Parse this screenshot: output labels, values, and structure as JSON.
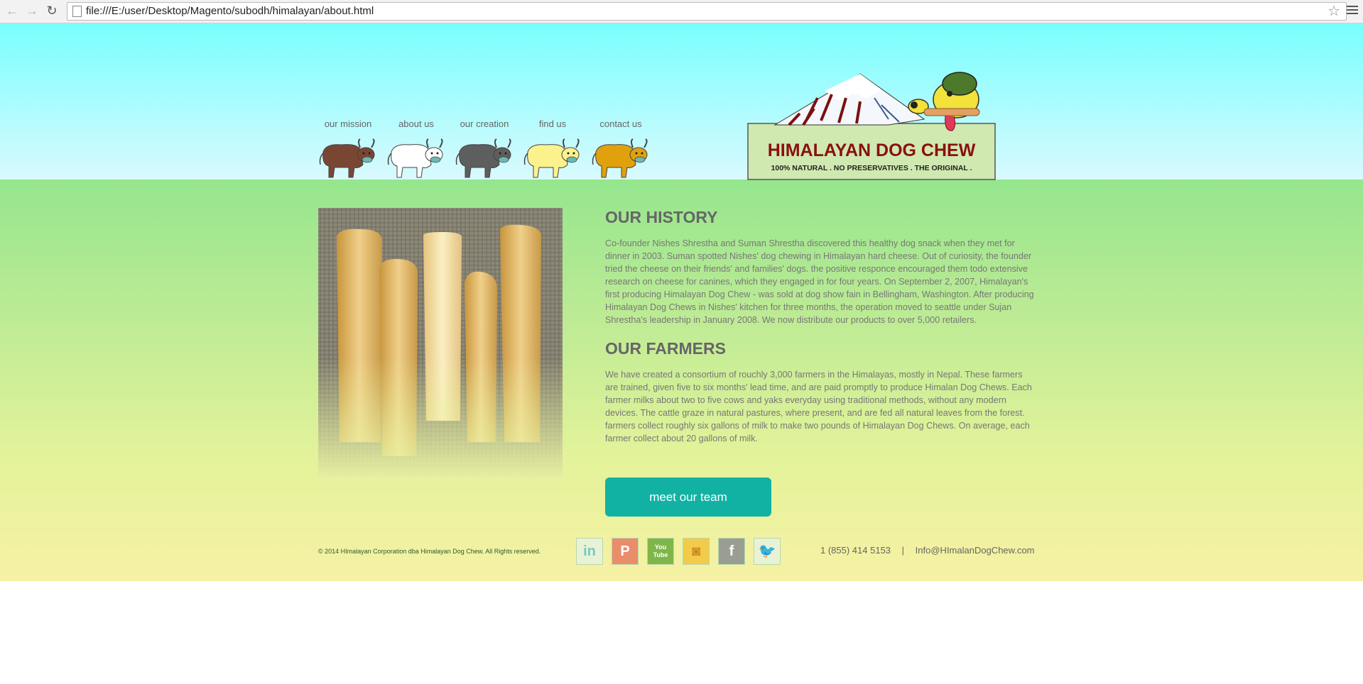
{
  "browser": {
    "url": "file:///E:/user/Desktop/Magento/subodh/himalayan/about.html"
  },
  "nav": {
    "items": [
      {
        "label": "our mission",
        "yak_color": "#7a4634"
      },
      {
        "label": "about us",
        "yak_color": "#ffffff"
      },
      {
        "label": "our creation",
        "yak_color": "#5e5e5e"
      },
      {
        "label": "find us",
        "yak_color": "#fbf28c"
      },
      {
        "label": "contact us",
        "yak_color": "#e0a10c"
      }
    ]
  },
  "logo": {
    "title": "HIMALAYAN DOG CHEW",
    "tagline": "100% NATURAL . NO PRESERVATIVES . THE ORIGINAL ."
  },
  "history": {
    "heading": "OUR HISTORY",
    "text": "Co-founder Nishes Shrestha and Suman Shrestha discovered this healthy dog snack when they met for dinner in 2003. Suman spotted Nishes' dog chewing in Himalayan hard cheese. Out of curiosity, the founder tried the cheese on their friends' and families' dogs. the positive responce encouraged them todo extensive research on cheese for canines, which they engaged in for four years. On September 2, 2007, Himalayan's first producing Himalayan Dog Chew - was sold at dog show fain in Bellingham, Washington. After producing Himalayan Dog Chews in Nishes' kitchen for three months, the operation moved to seattle under Sujan Shrestha's leadership in January 2008. We now distribute our products to over 5,000 retailers."
  },
  "farmers": {
    "heading": "OUR FARMERS",
    "text": "We have created a consortium of rouchly 3,000 farmers in the Himalayas, mostly in Nepal. These farmers are trained, given five to six months' lead time, and are paid promptly to produce Himalan Dog Chews. Each farmer milks about two to five cows and yaks everyday using traditional methods, without any modern devices. The cattle graze in natural pastures, where present, and are fed all natural leaves from the forest. farmers collect roughly six gallons of milk to make two pounds of Himalayan Dog Chews. On average, each farmer collect about 20 gallons of milk."
  },
  "team_button": "meet our team",
  "footer": {
    "copyright": "© 2014 HImalayan Corporation dba Himalayan Dog Chew. All Rights reserved.",
    "phone": "1 (855) 414 5153",
    "separator": "|",
    "email": "Info@HImalanDogChew.com",
    "social": [
      {
        "name": "linkedin-icon",
        "glyph": "in",
        "color": "#e8f3d6",
        "text_color": "#79c7c2"
      },
      {
        "name": "pinterest-icon",
        "glyph": "P",
        "color": "#e98d6a",
        "text_color": "#ffffff"
      },
      {
        "name": "youtube-icon",
        "glyph": "You Tube",
        "color": "#7fb64a",
        "text_color": "#ffffff"
      },
      {
        "name": "instagram-icon",
        "glyph": "◙",
        "color": "#f2cb4a",
        "text_color": "#c98a1e"
      },
      {
        "name": "facebook-icon",
        "glyph": "f",
        "color": "#9a9e92",
        "text_color": "#ffffff"
      },
      {
        "name": "twitter-icon",
        "glyph": "🐦",
        "color": "#e8f3d6",
        "text_color": "#63c8d6"
      }
    ]
  }
}
